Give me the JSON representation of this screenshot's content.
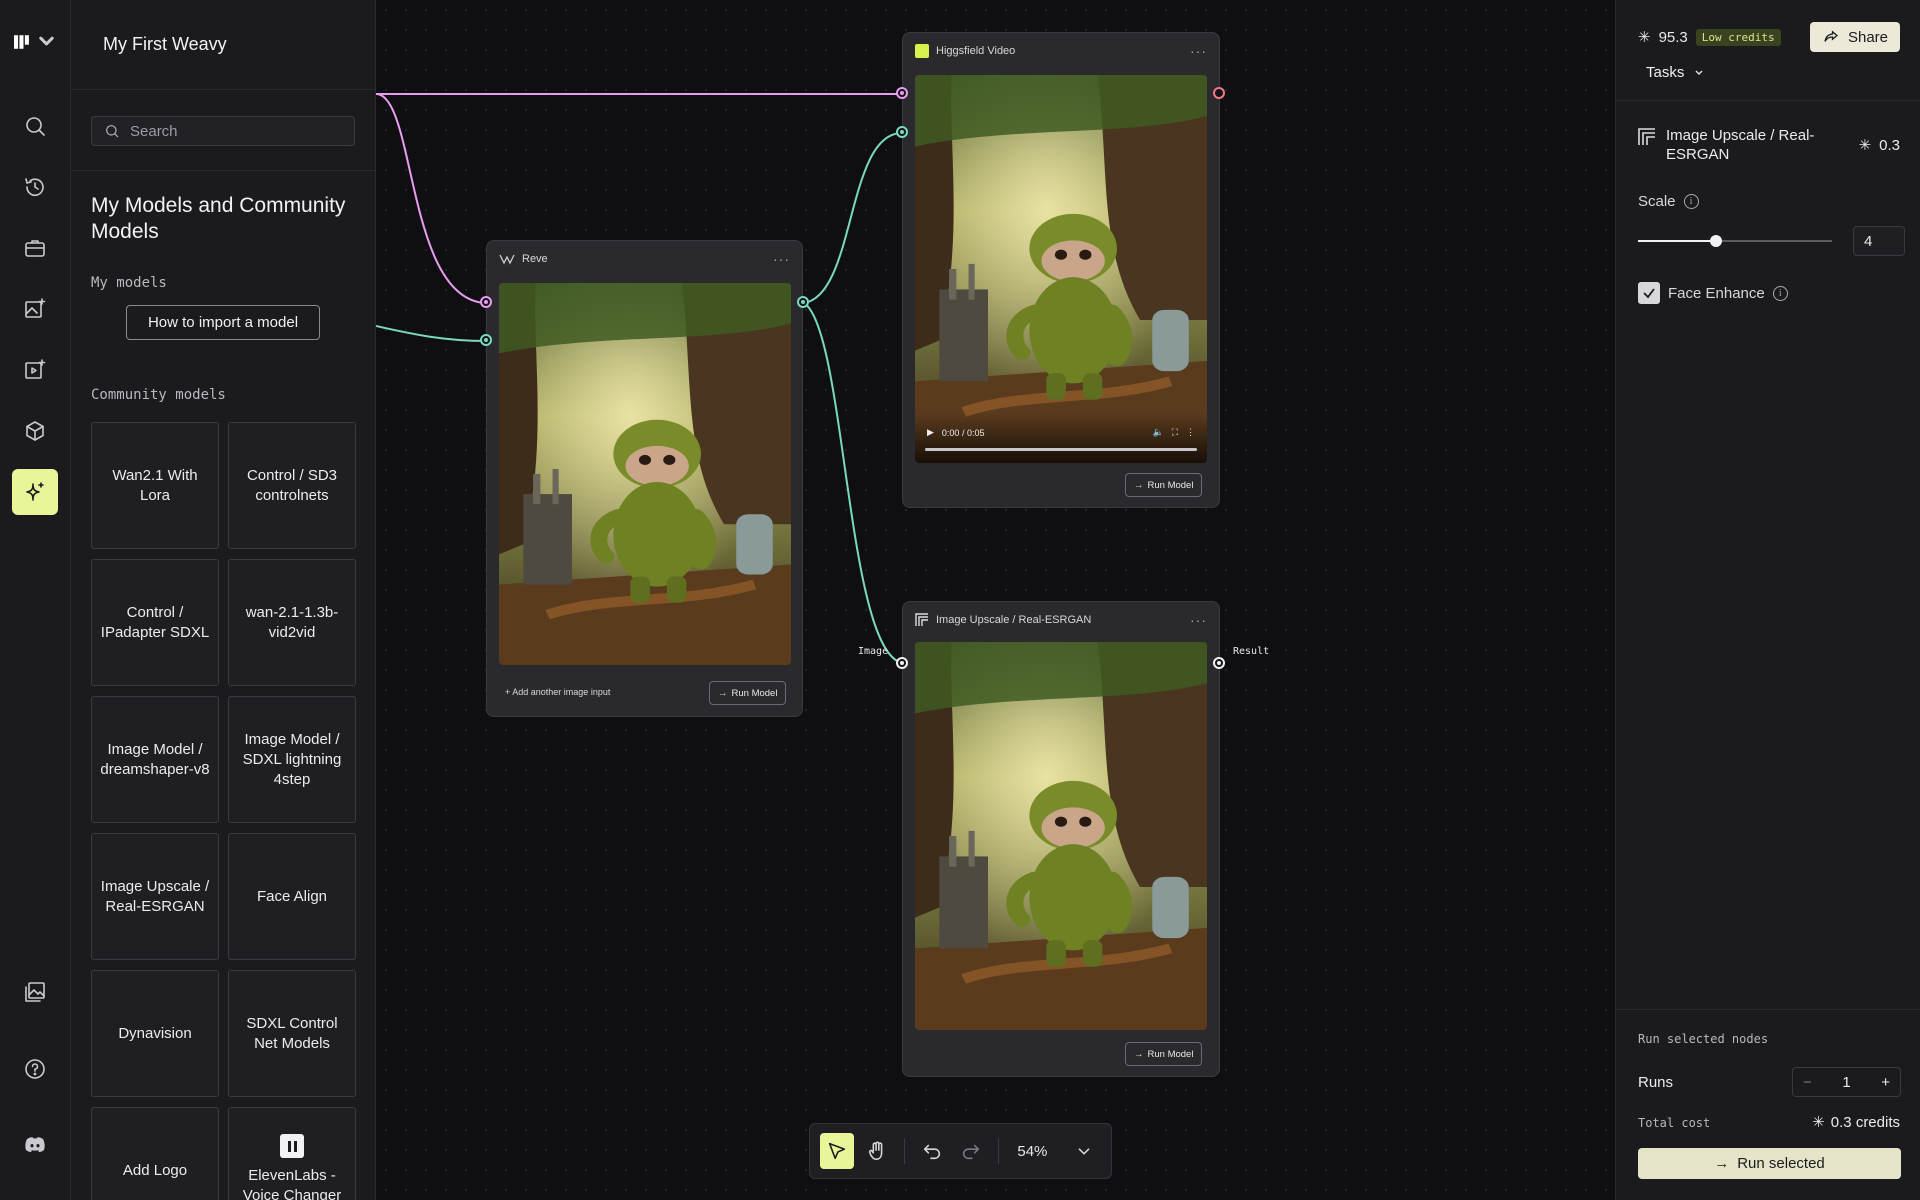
{
  "project": {
    "title": "My First Weavy"
  },
  "search": {
    "placeholder": "Search"
  },
  "library": {
    "heading": "My Models and Community Models",
    "my_models_label": "My models",
    "import_button": "How to import a model",
    "community_label": "Community models",
    "models": [
      "Wan2.1 With Lora",
      "Control / SD3 controlnets",
      "Control / IPadapter SDXL",
      "wan-2.1-1.3b-vid2vid",
      "Image Model / dreamshaper-v8",
      "Image Model / SDXL lightning 4step",
      "Image Upscale / Real-ESRGAN",
      "Face Align",
      "Dynavision",
      "SDXL Control Net Models",
      "Add Logo",
      "ElevenLabs - Voice Changer"
    ]
  },
  "nodes": {
    "reve": {
      "title": "Reve",
      "add_input": "Add another image input",
      "run": "Run Model"
    },
    "higgsfield": {
      "title": "Higgsfield Video",
      "time": "0:00 / 0:05",
      "run": "Run Model"
    },
    "upscale": {
      "title": "Image Upscale / Real-ESRGAN",
      "input_label": "Image",
      "output_label": "Result",
      "run": "Run Model"
    }
  },
  "toolbar": {
    "zoom": "54%"
  },
  "right_panel": {
    "credits": "95.3",
    "credits_badge": "Low credits",
    "share": "Share",
    "tasks": "Tasks",
    "model_title": "Image Upscale / Real-ESRGAN",
    "model_cost": "0.3",
    "scale_label": "Scale",
    "scale_value": "4",
    "scale_fraction": 0.4,
    "face_enhance_label": "Face Enhance",
    "face_enhance_checked": true,
    "run_selected_heading": "Run selected nodes",
    "runs_label": "Runs",
    "runs_value": "1",
    "total_cost_label": "Total cost",
    "total_cost_value": "0.3 credits",
    "run_selected_button": "Run selected"
  },
  "colors": {
    "accent": "#eaf59a",
    "wire_pink": "#e99cf0",
    "wire_green": "#78d8c0"
  }
}
